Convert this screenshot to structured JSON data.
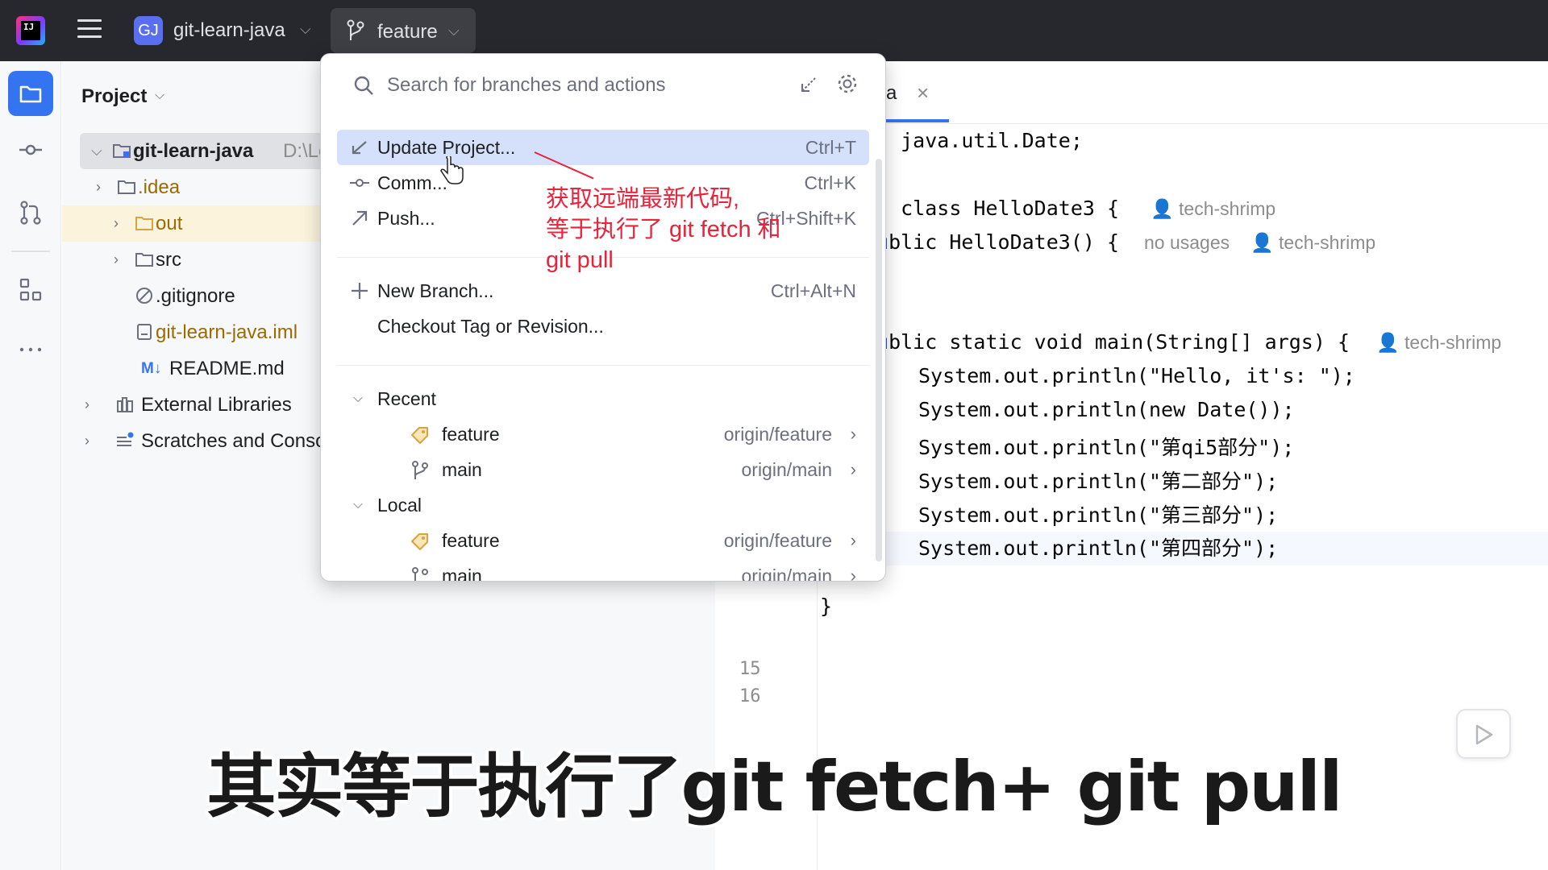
{
  "titlebar": {
    "logo_text": "IJ",
    "project_badge": "GJ",
    "project_name": "git-learn-java",
    "branch_name": "feature"
  },
  "project_panel": {
    "title": "Project",
    "tree": [
      {
        "label": "git-learn-java",
        "suffix": "D:\\Le"
      },
      {
        "label": ".idea"
      },
      {
        "label": "out"
      },
      {
        "label": "src"
      },
      {
        "label": ".gitignore"
      },
      {
        "label": "git-learn-java.iml"
      },
      {
        "label": "README.md",
        "badge": "M↓"
      },
      {
        "label": "External Libraries"
      },
      {
        "label": "Scratches and Conso"
      }
    ]
  },
  "editor": {
    "tab_label": "va",
    "line_numbers": [
      "15",
      "16"
    ],
    "code": [
      "java.util.Date;",
      "class HelloDate3 {",
      "blic HelloDate3() {",
      "blic static void main(String[] args) {",
      "System.out.println(\"Hello, it's: \");",
      "System.out.println(new Date());",
      "System.out.println(\"第qi5部分\");",
      "System.out.println(\"第二部分\");",
      "System.out.println(\"第三部分\");",
      "System.out.println(\"第四部分\");",
      "}"
    ],
    "hints": {
      "author": "tech-shrimp",
      "no_usages": "no usages"
    }
  },
  "popup": {
    "search_placeholder": "Search for branches and actions",
    "actions": [
      {
        "label": "Update Project...",
        "shortcut": "Ctrl+T"
      },
      {
        "label": "Comm...",
        "shortcut": "Ctrl+K"
      },
      {
        "label": "Push...",
        "shortcut": "Ctrl+Shift+K"
      },
      {
        "label": "New Branch...",
        "shortcut": "Ctrl+Alt+N"
      },
      {
        "label": "Checkout Tag or Revision..."
      }
    ],
    "groups": {
      "recent": {
        "label": "Recent",
        "branches": [
          {
            "name": "feature",
            "remote": "origin/feature"
          },
          {
            "name": "main",
            "remote": "origin/main"
          }
        ]
      },
      "local": {
        "label": "Local",
        "branches": [
          {
            "name": "feature",
            "remote": "origin/feature"
          },
          {
            "name": "main",
            "remote": "origin/main"
          }
        ]
      }
    }
  },
  "annotation": {
    "lines": [
      "获取远端最新代码,",
      "等于执行了 git fetch 和",
      "git pull"
    ],
    "color": "#e8233b"
  },
  "subtitle": "其实等于执行了git fetch+ git pull",
  "colors": {
    "accent": "#3574f0",
    "titlebar": "#27282e",
    "highlight": "#d5e1fb"
  }
}
